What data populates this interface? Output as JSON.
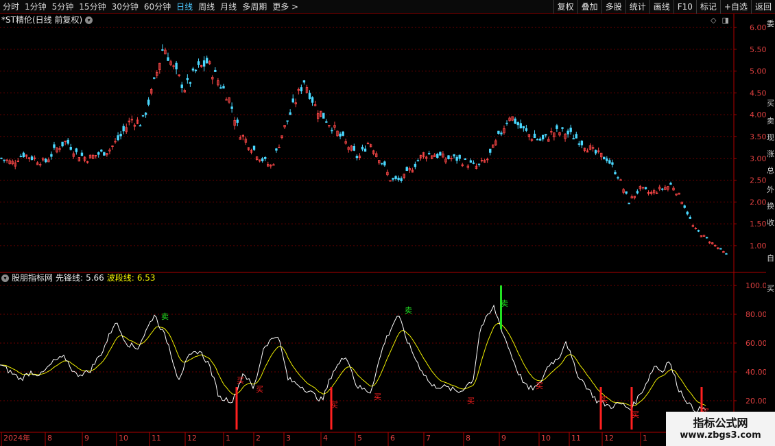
{
  "toolbar": {
    "periods": [
      "分时",
      "1分钟",
      "5分钟",
      "15分钟",
      "30分钟",
      "60分钟",
      "日线",
      "周线",
      "月线",
      "多周期",
      "更多"
    ],
    "active_period": "日线",
    "more_arrow": ">",
    "buttons": [
      "复权",
      "叠加",
      "多股",
      "统计",
      "画线",
      "F10",
      "标记",
      "+自选",
      "返回"
    ]
  },
  "main_chart": {
    "title": "*ST精伦(日线 前复权)",
    "price_ticks": [
      "6.00",
      "5.50",
      "5.00",
      "4.50",
      "4.00",
      "3.50",
      "3.00",
      "2.50",
      "2.00",
      "1.50",
      "1.00"
    ],
    "colors": {
      "up": "#ff4848",
      "down": "#4ad8ff",
      "grid": "#6e0000",
      "axis": "#b00000"
    }
  },
  "indicator": {
    "name": "股朋指标网",
    "line1_label": "先锋线:",
    "line1_value": "5.66",
    "line2_label": "波段线:",
    "line2_value": "6.53",
    "ticks": [
      "100.0",
      "80.00",
      "60.00",
      "40.00",
      "20.00"
    ],
    "sell_label": "卖",
    "buy_label": "买",
    "colors": {
      "line1": "#ffffff",
      "line2": "#f0f000",
      "sell": "#22e022",
      "buy": "#ff2020"
    }
  },
  "x_axis": {
    "labels": [
      "2024年",
      "8",
      "9",
      "10",
      "11",
      "12",
      "1",
      "2",
      "3",
      "4",
      "5",
      "6",
      "7",
      "8",
      "9",
      "10",
      "11",
      "12",
      "1"
    ]
  },
  "right_strip": {
    "chars": [
      "委",
      "买",
      "卖",
      "现",
      "涨",
      "总",
      "外",
      "换",
      "收",
      "自",
      "买"
    ]
  },
  "watermark": {
    "title": "指标公式网",
    "url": "www.zbgs3.com"
  },
  "chart_data": {
    "type": "candlestick",
    "title": "*ST精伦(日线 前复权)",
    "ylim": [
      0.7,
      6.2
    ],
    "approx_close_path": [
      3.0,
      2.9,
      3.1,
      3.0,
      2.9,
      3.2,
      3.4,
      3.1,
      3.0,
      3.1,
      3.2,
      3.5,
      3.9,
      3.8,
      4.6,
      5.6,
      5.0,
      4.6,
      5.0,
      5.2,
      4.8,
      4.4,
      3.6,
      3.3,
      3.0,
      2.8,
      3.6,
      4.2,
      4.8,
      4.2,
      3.9,
      3.6,
      3.3,
      3.0,
      3.4,
      3.0,
      2.5,
      2.5,
      2.8,
      3.1,
      3.1,
      3.0,
      3.0,
      2.9,
      2.8,
      3.0,
      3.5,
      4.0,
      3.7,
      3.5,
      3.4,
      3.6,
      3.6,
      3.5,
      3.3,
      3.1,
      3.0,
      2.6,
      2.0,
      2.3,
      2.2,
      2.3,
      2.4,
      2.0,
      1.4,
      1.2,
      1.0,
      0.8
    ],
    "indicator_series": [
      {
        "name": "先锋线",
        "last": 5.66
      },
      {
        "name": "波段线",
        "last": 6.53
      }
    ],
    "indicator_ylim": [
      10,
      100
    ]
  }
}
